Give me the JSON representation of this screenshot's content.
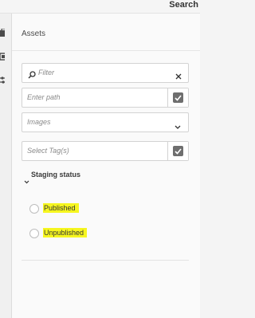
{
  "topbar": {
    "title": "Search"
  },
  "rail": {
    "icons": [
      "briefcase-icon",
      "layers-icon",
      "sliders-icon"
    ]
  },
  "panel": {
    "header": "Assets",
    "filter": {
      "placeholder": "Filter",
      "clear_icon": "close-icon",
      "search_icon": "search-icon"
    },
    "path": {
      "placeholder": "Enter path",
      "action_icon": "checkbox-icon"
    },
    "type_select": {
      "value": "Images",
      "icon": "chevron-down-icon"
    },
    "tags": {
      "placeholder": "Select Tag(s)",
      "action_icon": "checkbox-icon"
    },
    "staging": {
      "heading": "Staging status",
      "options": [
        {
          "label": "Published",
          "highlight_color": "#f6f61f"
        },
        {
          "label": "Unpublished",
          "highlight_color": "#f6f61f"
        }
      ]
    }
  }
}
